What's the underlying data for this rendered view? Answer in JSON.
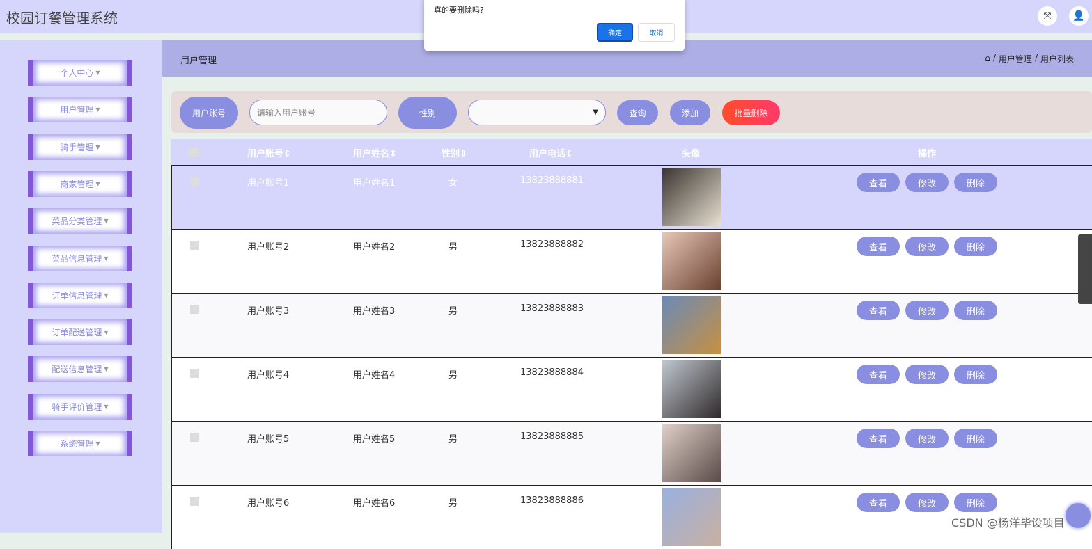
{
  "app": {
    "title": "校园订餐管理系统"
  },
  "header_icons": [
    "fullscreen-icon",
    "user-icon"
  ],
  "sidebar": {
    "items": [
      {
        "label": "个人中心"
      },
      {
        "label": "用户管理"
      },
      {
        "label": "骑手管理"
      },
      {
        "label": "商家管理"
      },
      {
        "label": "菜品分类管理"
      },
      {
        "label": "菜品信息管理"
      },
      {
        "label": "订单信息管理"
      },
      {
        "label": "订单配送管理"
      },
      {
        "label": "配送信息管理"
      },
      {
        "label": "骑手评价管理"
      },
      {
        "label": "系统管理"
      }
    ]
  },
  "breadcrumb": {
    "title": "用户管理",
    "home_icon": "home-icon",
    "items": [
      "用户管理",
      "用户列表"
    ],
    "sep": "/"
  },
  "search": {
    "account_label": "用户账号",
    "account_placeholder": "请输入用户账号",
    "gender_label": "性别",
    "gender_value": "",
    "query": "查询",
    "add": "添加",
    "batch_delete": "批量删除"
  },
  "table": {
    "headers": [
      "用户账号",
      "用户姓名",
      "性别",
      "用户电话",
      "头像",
      "操作"
    ],
    "sort_glyph": "⇕",
    "rows": [
      {
        "account": "用户账号1",
        "name": "用户姓名1",
        "gender": "女",
        "phone": "13823888881"
      },
      {
        "account": "用户账号2",
        "name": "用户姓名2",
        "gender": "男",
        "phone": "13823888882"
      },
      {
        "account": "用户账号3",
        "name": "用户姓名3",
        "gender": "男",
        "phone": "13823888883"
      },
      {
        "account": "用户账号4",
        "name": "用户姓名4",
        "gender": "男",
        "phone": "13823888884"
      },
      {
        "account": "用户账号5",
        "name": "用户姓名5",
        "gender": "男",
        "phone": "13823888885"
      },
      {
        "account": "用户账号6",
        "name": "用户姓名6",
        "gender": "男",
        "phone": "13823888886"
      }
    ],
    "actions": {
      "view": "查看",
      "edit": "修改",
      "delete": "删除"
    }
  },
  "dialog": {
    "message": "真的要删除吗?",
    "confirm": "确定",
    "cancel": "取消"
  },
  "watermark": "CSDN @杨洋毕设项目",
  "colors": {
    "accent": "#8a8ee0",
    "danger": "#ff4c2c",
    "header_bg": "#d6d6fc",
    "crumb_bg": "#aeaee6",
    "confirm": "#1a73e8"
  }
}
